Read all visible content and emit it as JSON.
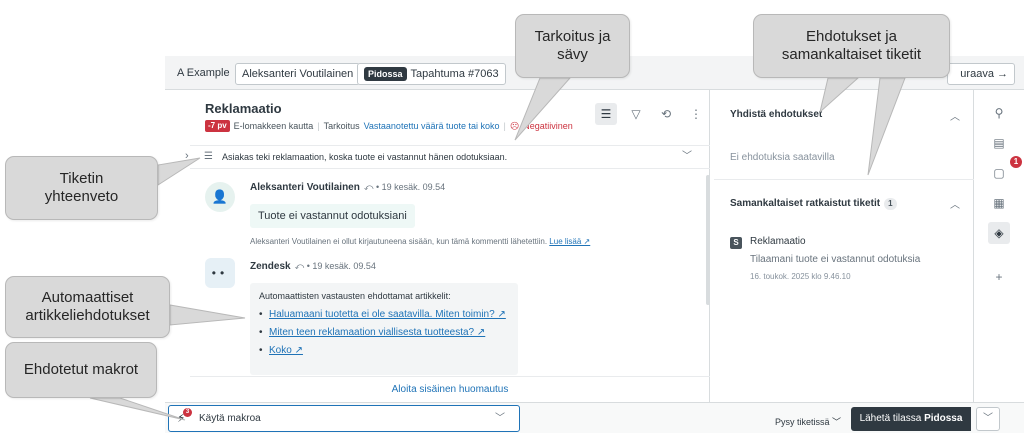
{
  "tabs": {
    "org": "A Example",
    "requester": "Aleksanteri Voutilainen",
    "status_badge": "Pidossa",
    "ticket": "Tapahtuma #7063",
    "next": "uraava →"
  },
  "ticket": {
    "title": "Reklamaatio",
    "age_badge": "-7 pv",
    "channel": "E-lomakkeen kautta",
    "purpose_label": "Tarkoitus",
    "purpose_value": "Vastaanotettu väärä tuote tai koko",
    "sentiment": "Negatiivinen",
    "summary": "Asiakas teki reklamaation, koska tuote ei vastannut hänen odotuksiaan."
  },
  "conversation": {
    "msg1": {
      "author": "Aleksanteri Voutilainen",
      "time": "⤺ • 19 kesäk. 09.54",
      "body": "Tuote ei vastannut odotuksiani",
      "note": "Aleksanteri Voutilainen ei ollut kirjautuneena sisään, kun tämä kommentti lähetettiin.",
      "note_link": "Lue lisää ↗"
    },
    "msg2": {
      "author": "Zendesk",
      "time": "⤺ • 19 kesäk. 09.54",
      "head": "Automaattisten vastausten ehdottamat artikkelit:",
      "articles": [
        "Haluamaani tuotetta ei ole saatavilla. Miten toimin? ↗",
        "Miten teen reklamaation viallisesta tuotteesta? ↗",
        "Koko ↗"
      ]
    },
    "internal_note": "Aloita sisäinen huomautus"
  },
  "suggestions": {
    "merge_header": "Yhdistä ehdotukset",
    "merge_empty": "Ei ehdotuksia saatavilla",
    "similar_header": "Samankaltaiset ratkaistut tiketit",
    "similar_count": "1",
    "item_icon": "S",
    "item_title": "Reklamaatio",
    "item_sub": "Tilaamani tuote ei vastannut odotuksia",
    "item_date": "16. toukok. 2025 klo 9.46.10"
  },
  "rail": {
    "apps_badge": "1"
  },
  "bottom": {
    "macro_placeholder": "Käytä makroa",
    "macro_badge": "3",
    "stay": "Pysy tiketissä ﹀",
    "submit_prefix": "Lähetä tilassa",
    "submit_status": "Pidossa"
  },
  "callouts": {
    "purpose": "Tarkoitus ja\nsävy",
    "suggestions": "Ehdotukset ja\nsamankaltaiset tiketit",
    "summary": "Tiketin\nyhteenveto",
    "articles": "Automaattiset\nartikkeliehdotukset",
    "macros": "Ehdotetut makrot"
  }
}
